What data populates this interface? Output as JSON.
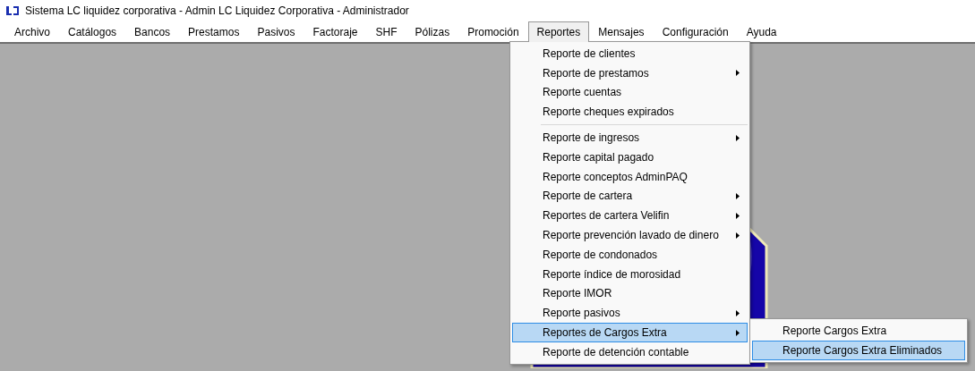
{
  "window": {
    "title": "Sistema LC liquidez corporativa - Admin LC Liquidez Corporativa - Administrador"
  },
  "menubar": [
    {
      "label": "Archivo",
      "selected": false
    },
    {
      "label": "Catálogos",
      "selected": false
    },
    {
      "label": "Bancos",
      "selected": false
    },
    {
      "label": "Prestamos",
      "selected": false
    },
    {
      "label": "Pasivos",
      "selected": false
    },
    {
      "label": "Factoraje",
      "selected": false
    },
    {
      "label": "SHF",
      "selected": false
    },
    {
      "label": "Pólizas",
      "selected": false
    },
    {
      "label": "Promoción",
      "selected": false
    },
    {
      "label": "Reportes",
      "selected": true
    },
    {
      "label": "Mensajes",
      "selected": false
    },
    {
      "label": "Configuración",
      "selected": false
    },
    {
      "label": "Ayuda",
      "selected": false
    }
  ],
  "dropdown": [
    {
      "kind": "item",
      "label": "Reporte de clientes",
      "submenu": false,
      "selected": false
    },
    {
      "kind": "item",
      "label": "Reporte de prestamos",
      "submenu": true,
      "selected": false
    },
    {
      "kind": "item",
      "label": "Reporte cuentas",
      "submenu": false,
      "selected": false
    },
    {
      "kind": "item",
      "label": "Reporte cheques expirados",
      "submenu": false,
      "selected": false
    },
    {
      "kind": "separator"
    },
    {
      "kind": "item",
      "label": "Reporte de ingresos",
      "submenu": true,
      "selected": false
    },
    {
      "kind": "item",
      "label": "Reporte capital pagado",
      "submenu": false,
      "selected": false
    },
    {
      "kind": "item",
      "label": "Reporte conceptos AdminPAQ",
      "submenu": false,
      "selected": false
    },
    {
      "kind": "item",
      "label": "Reporte de cartera",
      "submenu": true,
      "selected": false
    },
    {
      "kind": "item",
      "label": "Reportes de cartera Velifin",
      "submenu": true,
      "selected": false
    },
    {
      "kind": "item",
      "label": "Reporte prevención lavado de dinero",
      "submenu": true,
      "selected": false
    },
    {
      "kind": "item",
      "label": "Reporte de condonados",
      "submenu": false,
      "selected": false
    },
    {
      "kind": "item",
      "label": "Reporte índice de morosidad",
      "submenu": false,
      "selected": false
    },
    {
      "kind": "item",
      "label": "Reporte IMOR",
      "submenu": false,
      "selected": false
    },
    {
      "kind": "item",
      "label": "Reporte pasivos",
      "submenu": true,
      "selected": false
    },
    {
      "kind": "item",
      "label": "Reportes de Cargos Extra",
      "submenu": true,
      "selected": true
    },
    {
      "kind": "item",
      "label": "Reporte de detención contable",
      "submenu": false,
      "selected": false
    }
  ],
  "submenu": [
    {
      "label": "Reporte Cargos Extra",
      "selected": false
    },
    {
      "label": "Reporte Cargos Extra Eliminados",
      "selected": true
    }
  ]
}
